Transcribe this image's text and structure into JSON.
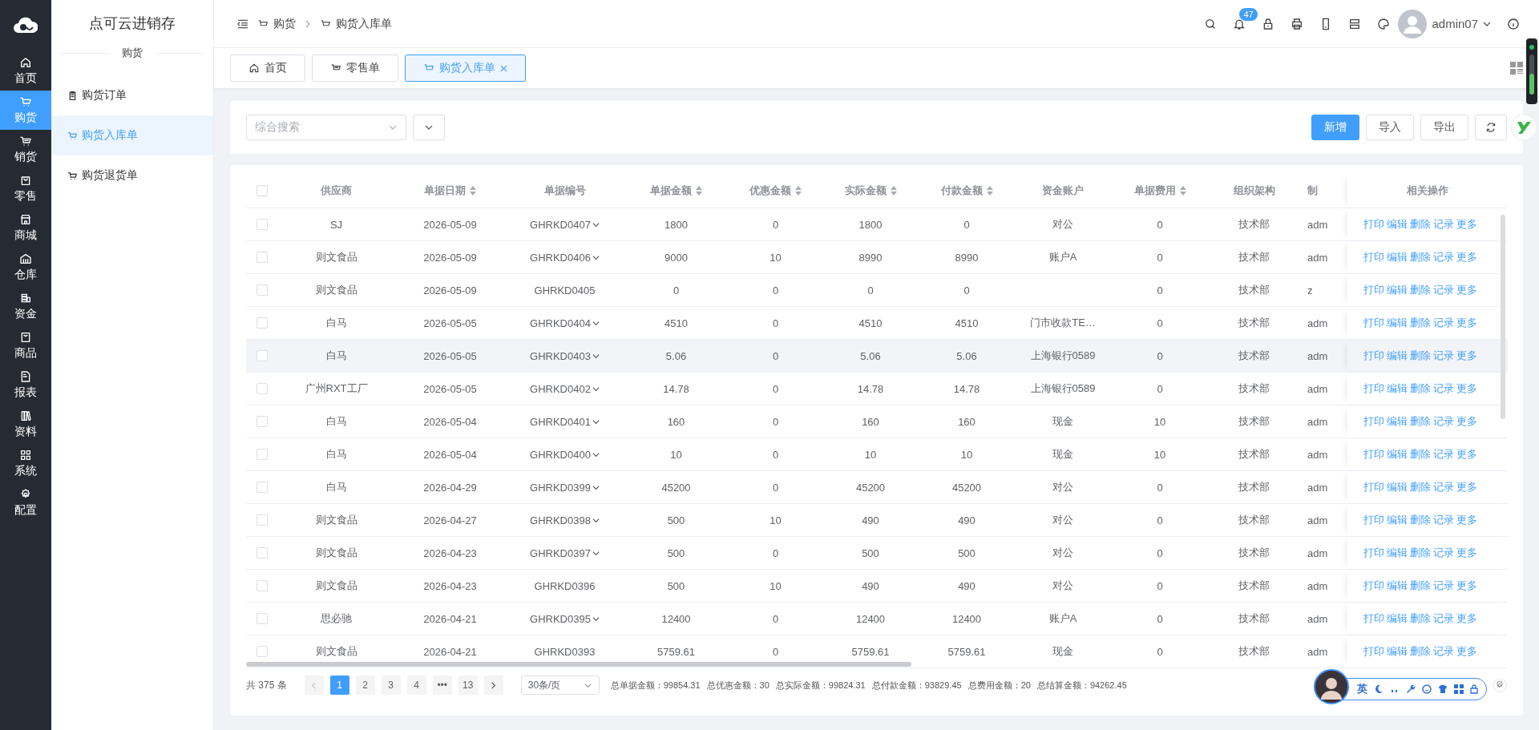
{
  "sidebar": {
    "items": [
      {
        "label": "首页",
        "selected": false
      },
      {
        "label": "购货",
        "selected": true
      },
      {
        "label": "销货",
        "selected": false
      },
      {
        "label": "零售",
        "selected": false
      },
      {
        "label": "商城",
        "selected": false
      },
      {
        "label": "仓库",
        "selected": false
      },
      {
        "label": "资金",
        "selected": false
      },
      {
        "label": "商品",
        "selected": false
      },
      {
        "label": "报表",
        "selected": false
      },
      {
        "label": "资料",
        "selected": false
      },
      {
        "label": "系统",
        "selected": false
      },
      {
        "label": "配置",
        "selected": false
      }
    ]
  },
  "app_title": "点可云进销存",
  "submenu": {
    "section": "购货",
    "items": [
      {
        "label": "购货订单",
        "selected": false
      },
      {
        "label": "购货入库单",
        "selected": true
      },
      {
        "label": "购货退货单",
        "selected": false
      }
    ]
  },
  "breadcrumb": [
    "购货",
    "购货入库单"
  ],
  "header": {
    "notification_count": "47",
    "username": "admin07"
  },
  "tabs": [
    {
      "label": "首页",
      "selected": false,
      "closable": false
    },
    {
      "label": "零售单",
      "selected": false,
      "closable": false
    },
    {
      "label": "购货入库单",
      "selected": true,
      "closable": true
    }
  ],
  "toolbar": {
    "search_placeholder": "综合搜索",
    "buttons": [
      {
        "label": "新增",
        "kind": "primary"
      },
      {
        "label": "导入",
        "kind": "default"
      },
      {
        "label": "导出",
        "kind": "default"
      }
    ]
  },
  "table": {
    "all_checked": false,
    "columns": [
      {
        "label": "供应商",
        "sortable": false
      },
      {
        "label": "单据日期",
        "sortable": true
      },
      {
        "label": "单据编号",
        "sortable": false
      },
      {
        "label": "单据金额",
        "sortable": true
      },
      {
        "label": "优惠金额",
        "sortable": true
      },
      {
        "label": "实际金额",
        "sortable": true
      },
      {
        "label": "付款金额",
        "sortable": true
      },
      {
        "label": "资金账户",
        "sortable": false
      },
      {
        "label": "单据费用",
        "sortable": true
      },
      {
        "label": "组织架构",
        "sortable": false
      },
      {
        "label": "制",
        "sortable": false
      },
      {
        "label": "相关操作",
        "sortable": false
      }
    ],
    "rows": [
      {
        "checked": false,
        "hovered": false,
        "expandable": true,
        "cells": [
          "SJ",
          "2026-05-09",
          "GHRKD0407",
          "1800",
          "0",
          "1800",
          "0",
          "对公",
          "0",
          "技术部",
          "adm"
        ],
        "actions": [
          "打印",
          "编辑",
          "删除",
          "记录",
          "更多"
        ]
      },
      {
        "checked": false,
        "hovered": false,
        "expandable": true,
        "cells": [
          "则文食品",
          "2026-05-09",
          "GHRKD0406",
          "9000",
          "10",
          "8990",
          "8990",
          "账户A",
          "0",
          "技术部",
          "adm"
        ],
        "actions": [
          "打印",
          "编辑",
          "删除",
          "记录",
          "更多"
        ]
      },
      {
        "checked": false,
        "hovered": false,
        "expandable": false,
        "cells": [
          "则文食品",
          "2026-05-09",
          "GHRKD0405",
          "0",
          "0",
          "0",
          "0",
          null,
          "0",
          "技术部",
          "z"
        ],
        "actions": [
          "打印",
          "编辑",
          "删除",
          "记录",
          "更多"
        ]
      },
      {
        "checked": false,
        "hovered": false,
        "expandable": true,
        "cells": [
          "白马",
          "2026-05-05",
          "GHRKD0404",
          "4510",
          "0",
          "4510",
          "4510",
          "门市收款TE…",
          "0",
          "技术部",
          "adm"
        ],
        "actions": [
          "打印",
          "编辑",
          "删除",
          "记录",
          "更多"
        ]
      },
      {
        "checked": false,
        "hovered": true,
        "expandable": true,
        "cells": [
          "白马",
          "2026-05-05",
          "GHRKD0403",
          "5.06",
          "0",
          "5.06",
          "5.06",
          "上海银行0589",
          "0",
          "技术部",
          "adm"
        ],
        "actions": [
          "打印",
          "编辑",
          "删除",
          "记录",
          "更多"
        ]
      },
      {
        "checked": false,
        "hovered": false,
        "expandable": true,
        "cells": [
          "广州RXT工厂",
          "2026-05-05",
          "GHRKD0402",
          "14.78",
          "0",
          "14.78",
          "14.78",
          "上海银行0589",
          "0",
          "技术部",
          "adm"
        ],
        "actions": [
          "打印",
          "编辑",
          "删除",
          "记录",
          "更多"
        ]
      },
      {
        "checked": false,
        "hovered": false,
        "expandable": true,
        "cells": [
          "白马",
          "2026-05-04",
          "GHRKD0401",
          "160",
          "0",
          "160",
          "160",
          "现金",
          "10",
          "技术部",
          "adm"
        ],
        "actions": [
          "打印",
          "编辑",
          "删除",
          "记录",
          "更多"
        ]
      },
      {
        "checked": false,
        "hovered": false,
        "expandable": true,
        "cells": [
          "白马",
          "2026-05-04",
          "GHRKD0400",
          "10",
          "0",
          "10",
          "10",
          "现金",
          "10",
          "技术部",
          "adm"
        ],
        "actions": [
          "打印",
          "编辑",
          "删除",
          "记录",
          "更多"
        ]
      },
      {
        "checked": false,
        "hovered": false,
        "expandable": true,
        "cells": [
          "白马",
          "2026-04-29",
          "GHRKD0399",
          "45200",
          "0",
          "45200",
          "45200",
          "对公",
          "0",
          "技术部",
          "adm"
        ],
        "actions": [
          "打印",
          "编辑",
          "删除",
          "记录",
          "更多"
        ]
      },
      {
        "checked": false,
        "hovered": false,
        "expandable": true,
        "cells": [
          "则文食品",
          "2026-04-27",
          "GHRKD0398",
          "500",
          "10",
          "490",
          "490",
          "对公",
          "0",
          "技术部",
          "adm"
        ],
        "actions": [
          "打印",
          "编辑",
          "删除",
          "记录",
          "更多"
        ]
      },
      {
        "checked": false,
        "hovered": false,
        "expandable": true,
        "cells": [
          "则文食品",
          "2026-04-23",
          "GHRKD0397",
          "500",
          "0",
          "500",
          "500",
          "对公",
          "0",
          "技术部",
          "adm"
        ],
        "actions": [
          "打印",
          "编辑",
          "删除",
          "记录",
          "更多"
        ]
      },
      {
        "checked": false,
        "hovered": false,
        "expandable": false,
        "cells": [
          "则文食品",
          "2026-04-23",
          "GHRKD0396",
          "500",
          "10",
          "490",
          "490",
          "对公",
          "0",
          "技术部",
          "adm"
        ],
        "actions": [
          "打印",
          "编辑",
          "删除",
          "记录",
          "更多"
        ]
      },
      {
        "checked": false,
        "hovered": false,
        "expandable": true,
        "cells": [
          "思必驰",
          "2026-04-21",
          "GHRKD0395",
          "12400",
          "0",
          "12400",
          "12400",
          "账户A",
          "0",
          "技术部",
          "adm"
        ],
        "actions": [
          "打印",
          "编辑",
          "删除",
          "记录",
          "更多"
        ]
      },
      {
        "checked": false,
        "hovered": false,
        "expandable": false,
        "cells": [
          "则文食品",
          "2026-04-21",
          "GHRKD0393",
          "5759.61",
          "0",
          "5759.61",
          "5759.61",
          "现金",
          "0",
          "技术部",
          "adm"
        ],
        "actions": [
          "打印",
          "编辑",
          "删除",
          "记录",
          "更多"
        ]
      }
    ]
  },
  "pagination": {
    "total": "共 375 条",
    "pages": [
      {
        "label": "1",
        "selected": true
      },
      {
        "label": "2",
        "selected": false
      },
      {
        "label": "3",
        "selected": false
      },
      {
        "label": "4",
        "selected": false
      },
      {
        "label": "•••",
        "selected": false
      },
      {
        "label": "13",
        "selected": false
      }
    ],
    "page_size": "30条/页",
    "totals": [
      "总单据金额：99854.31",
      "总优惠金额：30",
      "总实际金额：99824.31",
      "总付款金额：93829.45",
      "总费用金额：20",
      "总结算金额：94262.45"
    ]
  },
  "ime_toolbar": {
    "mode": "英"
  }
}
